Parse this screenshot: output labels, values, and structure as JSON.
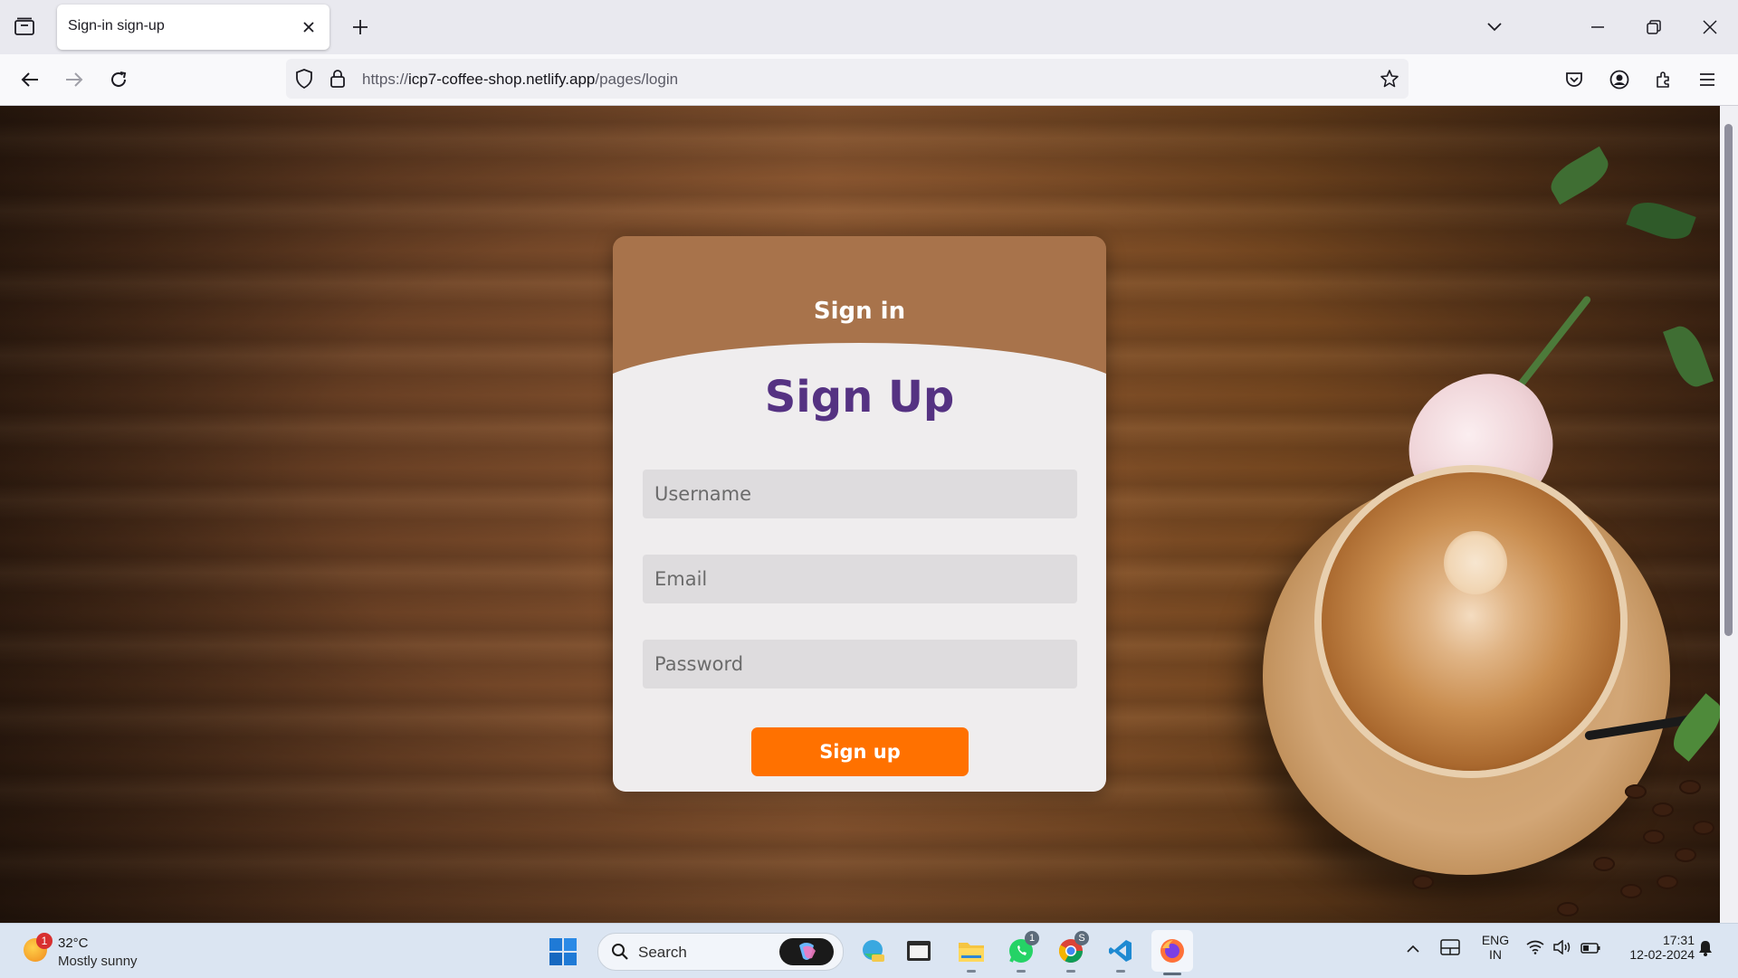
{
  "browser": {
    "tab_title": "Sign-in sign-up",
    "url_scheme": "https://",
    "url_host": "icp7-coffee-shop.netlify.app",
    "url_path": "/pages/login"
  },
  "page": {
    "signin_label": "Sign in",
    "signup_title": "Sign Up",
    "fields": {
      "username_placeholder": "Username",
      "email_placeholder": "Email",
      "password_placeholder": "Password"
    },
    "submit_label": "Sign up",
    "colors": {
      "card_header": "#a8734b",
      "title_purple": "#553282",
      "button_orange": "#ff7100"
    }
  },
  "taskbar": {
    "weather_temp": "32°C",
    "weather_condition": "Mostly sunny",
    "weather_badge": "1",
    "search_label": "Search",
    "whatsapp_badge": "1",
    "chrome_badge": "S",
    "lang_line1": "ENG",
    "lang_line2": "IN",
    "time": "17:31",
    "date": "12-02-2024",
    "app_icons": [
      "copilot-icon",
      "edge-beta-icon",
      "terminal-icon",
      "file-explorer-icon",
      "whatsapp-icon",
      "chrome-icon",
      "vscode-icon",
      "firefox-icon"
    ]
  }
}
